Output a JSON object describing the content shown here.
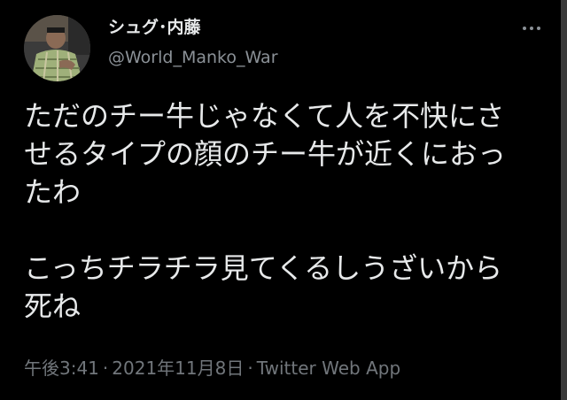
{
  "tweet": {
    "author": {
      "display_name": "シュグ･内藤",
      "handle": "@World_Manko_War"
    },
    "text_lines_p1": [
      "ただのチー牛じゃなくて人を不快にさ",
      "せるタイプの顔のチー牛が近くにおっ",
      "たわ"
    ],
    "text_lines_p2": [
      "こっちチラチラ見てくるしうざいから",
      "死ね"
    ],
    "timestamp": "午後3:41",
    "date": "2021年11月8日",
    "separator": "·",
    "source": "Twitter Web App"
  },
  "colors": {
    "background": "#000000",
    "primary_text": "#e7e9ea",
    "secondary_text": "#71767b"
  },
  "icons": {
    "more": "more-horizontal-icon"
  }
}
